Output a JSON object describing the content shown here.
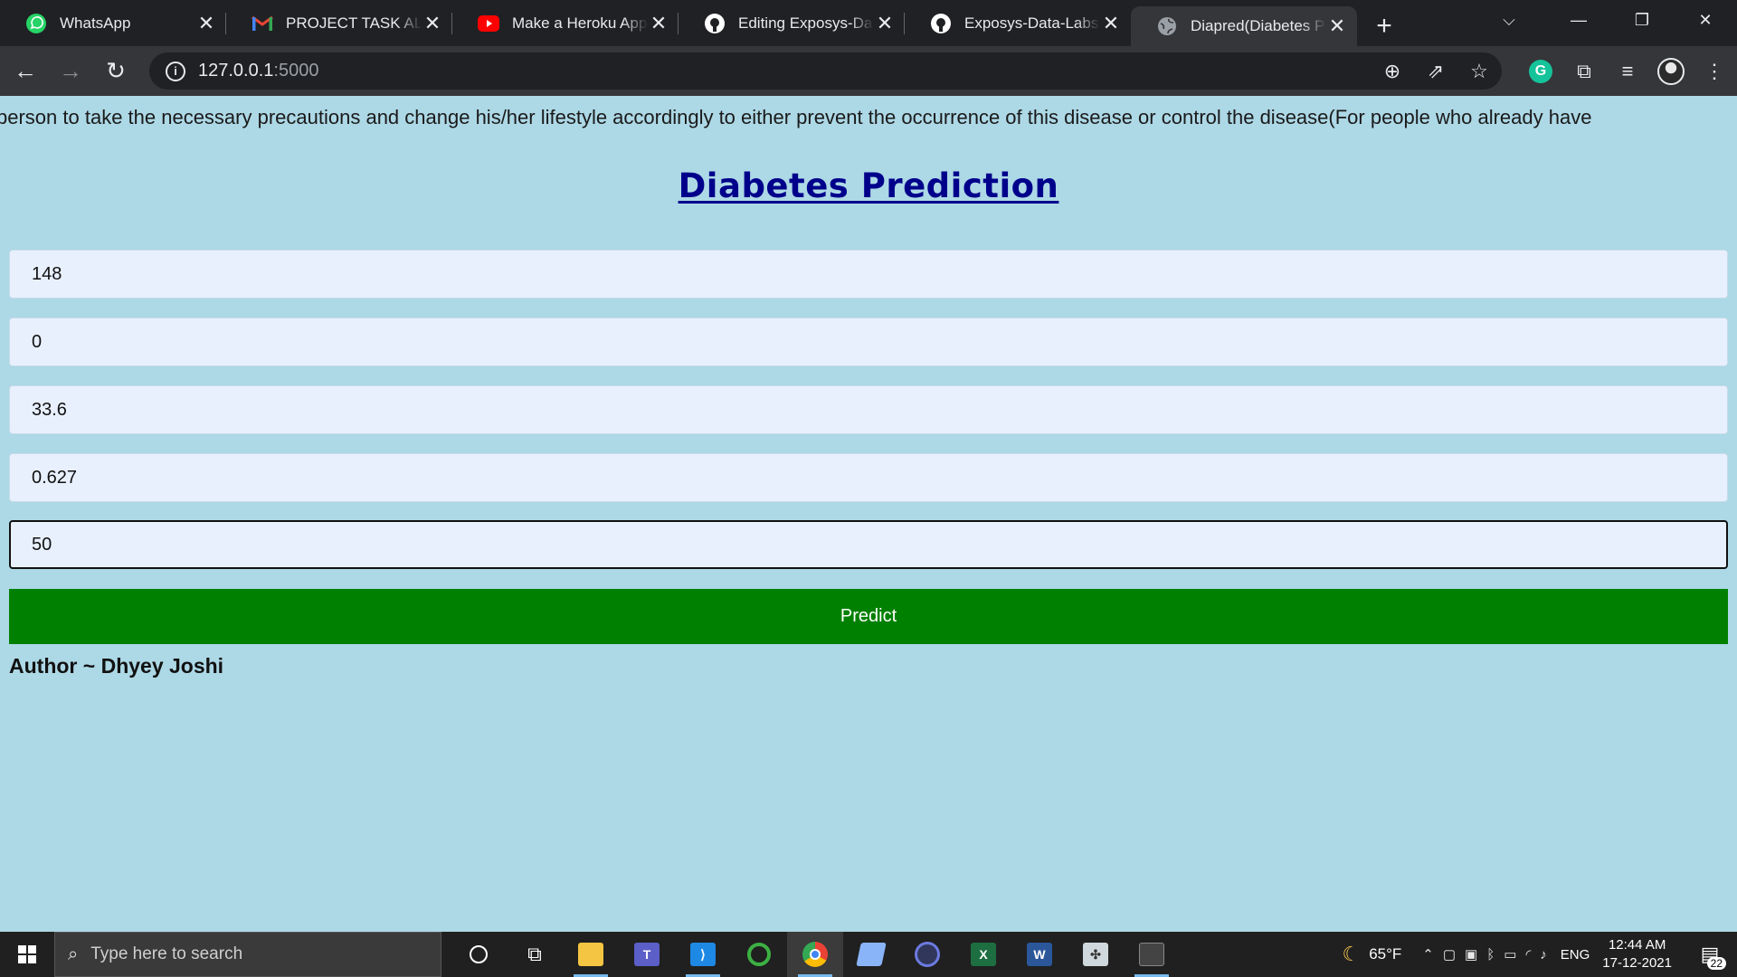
{
  "browser": {
    "tabs": [
      {
        "title": "WhatsApp",
        "icon": "whatsapp-icon"
      },
      {
        "title": "PROJECT TASK ALLOCATION",
        "icon": "gmail-icon"
      },
      {
        "title": "Make a Heroku App",
        "icon": "youtube-icon"
      },
      {
        "title": "Editing Exposys-Data",
        "icon": "github-icon"
      },
      {
        "title": "Exposys-Data-Labs-In",
        "icon": "github-icon"
      },
      {
        "title": "Diapred(Diabetes Prediction)",
        "icon": "globe-icon"
      }
    ],
    "url_host": "127.0.0.1",
    "url_port": ":5000"
  },
  "page": {
    "marquee": "person to take the necessary precautions and change his/her lifestyle accordingly to either prevent the occurrence of this disease or control the disease(For people who already have",
    "title": "Diabetes Prediction",
    "fields": [
      {
        "value": "148"
      },
      {
        "value": "0"
      },
      {
        "value": "33.6"
      },
      {
        "value": "0.627"
      },
      {
        "value": "50"
      }
    ],
    "predict_label": "Predict",
    "author": "Author ~ Dhyey Joshi"
  },
  "taskbar": {
    "search_placeholder": "Type here to search",
    "temperature": "65°F",
    "language": "ENG",
    "time": "12:44 AM",
    "date": "17-12-2021",
    "notification_count": "22"
  },
  "colors": {
    "page_background": "#add8e6",
    "title": "#00008b",
    "predict_button": "#008000",
    "input_background": "#e8f0fe"
  }
}
